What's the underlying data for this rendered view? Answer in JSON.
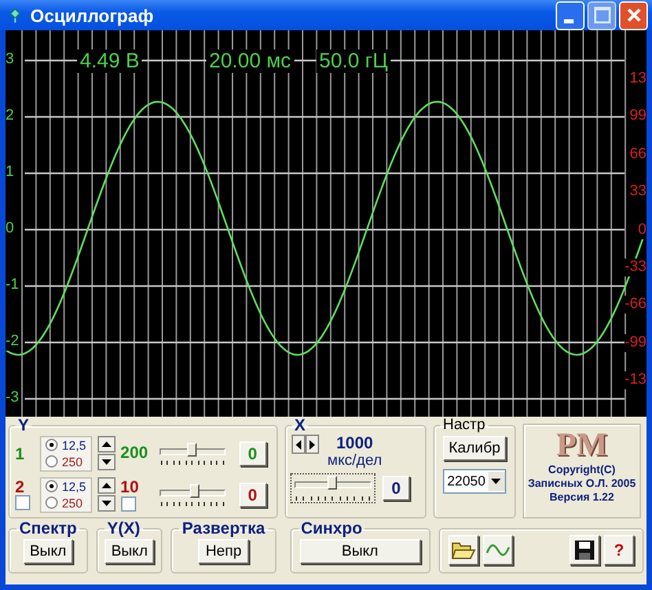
{
  "window": {
    "title": "Осциллограф"
  },
  "scope": {
    "readouts": [
      "4.49 В",
      "20.00 мс",
      "50.0 гЦ"
    ],
    "left_axis": [
      "3",
      "2",
      "1",
      "0",
      "-1",
      "-2",
      "-3"
    ],
    "right_axis": [
      "13",
      "99",
      "66",
      "33",
      "0",
      "-33",
      "-66",
      "-99",
      "-13"
    ]
  },
  "y_panel": {
    "title": "Y",
    "channels": [
      {
        "label": "1",
        "color": "#18901c",
        "radios": [
          {
            "label": "12,5",
            "selected": true
          },
          {
            "label": "250",
            "selected": false
          }
        ],
        "value": "200",
        "level": 0.5,
        "zero": "0"
      },
      {
        "label": "2",
        "color": "#b01010",
        "radios": [
          {
            "label": "12,5",
            "selected": true
          },
          {
            "label": "250",
            "selected": false
          }
        ],
        "value": "10",
        "level": 0.55,
        "zero": "0",
        "enable_checked": false,
        "invert_checked": false
      }
    ]
  },
  "x_panel": {
    "title": "X",
    "value": "1000",
    "unit": "мкс/дел",
    "level": 0.5,
    "zero": "0"
  },
  "settings": {
    "title": "Настр",
    "calibrate": "Калибр",
    "sample_rate": "22050"
  },
  "about": {
    "logo": "PM",
    "lines": [
      "Copyright(C)",
      "Записных О.Л. 2005",
      "Версия 1.22"
    ]
  },
  "modes": [
    {
      "title": "Спектр",
      "button": "Выкл"
    },
    {
      "title": "Y(X)",
      "button": "Выкл"
    },
    {
      "title": "Развертка",
      "button": "Непр"
    },
    {
      "title": "Синхро",
      "button": "Выкл"
    }
  ],
  "toolbar": {
    "help": "?"
  }
}
